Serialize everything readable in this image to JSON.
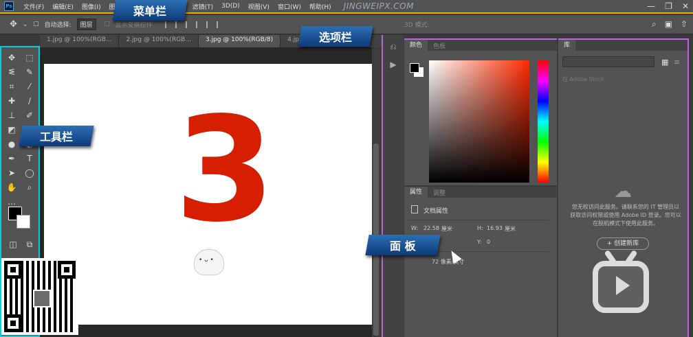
{
  "app": {
    "logo": "Ps",
    "watermark": "JINGWEIPX.COM"
  },
  "menu": [
    "文件(F)",
    "编辑(E)",
    "图像(I)",
    "图",
    "滤镜(T)",
    "3D(D)",
    "视图(V)",
    "窗口(W)",
    "帮助(H)"
  ],
  "window_controls": {
    "minimize": "—",
    "restore": "❐",
    "close": "✕"
  },
  "options": {
    "auto_select_label": "自动选择:",
    "auto_select_value": "图层",
    "transform_label": "显示变换控件",
    "mode_3d_label": "3D 模式:"
  },
  "tabs": [
    "1.jpg @ 100%(RGB...",
    "2.jpg @ 100%(RGB...",
    "3.jpg @ 100%(RGB/8)",
    "4.jp"
  ],
  "canvas": {
    "big_text": "3"
  },
  "panels": {
    "color_tabs": [
      "颜色",
      "色板"
    ],
    "props_tabs": [
      "属性",
      "调整"
    ],
    "props_title": "文档属性",
    "width_label": "W:",
    "width_value": "22.58",
    "width_unit": "厘米",
    "height_label": "H:",
    "height_value": "16.93",
    "height_unit": "厘米",
    "y_label": "Y:",
    "y_value": "0",
    "resolution_text": "72 像素/英寸",
    "library_tab": "库",
    "library_search_placeholder": "在 Adobe Stock",
    "library_message": "您无权访问此服务。请联系您的 IT 管理员以获取访问权限或使用 Adobe ID 登录。您可以在脱机模式下使用此服务。",
    "library_create_button": "+ 创建新库"
  },
  "callouts": {
    "menubar": "菜单栏",
    "optionsbar": "选项栏",
    "toolbar": "工具栏",
    "panels": "面 板"
  },
  "colors": {
    "accent_yellow": "#e6b400",
    "accent_cyan": "#19c6d6",
    "accent_purple": "#b06bd8",
    "canvas_red": "#d61f00"
  }
}
